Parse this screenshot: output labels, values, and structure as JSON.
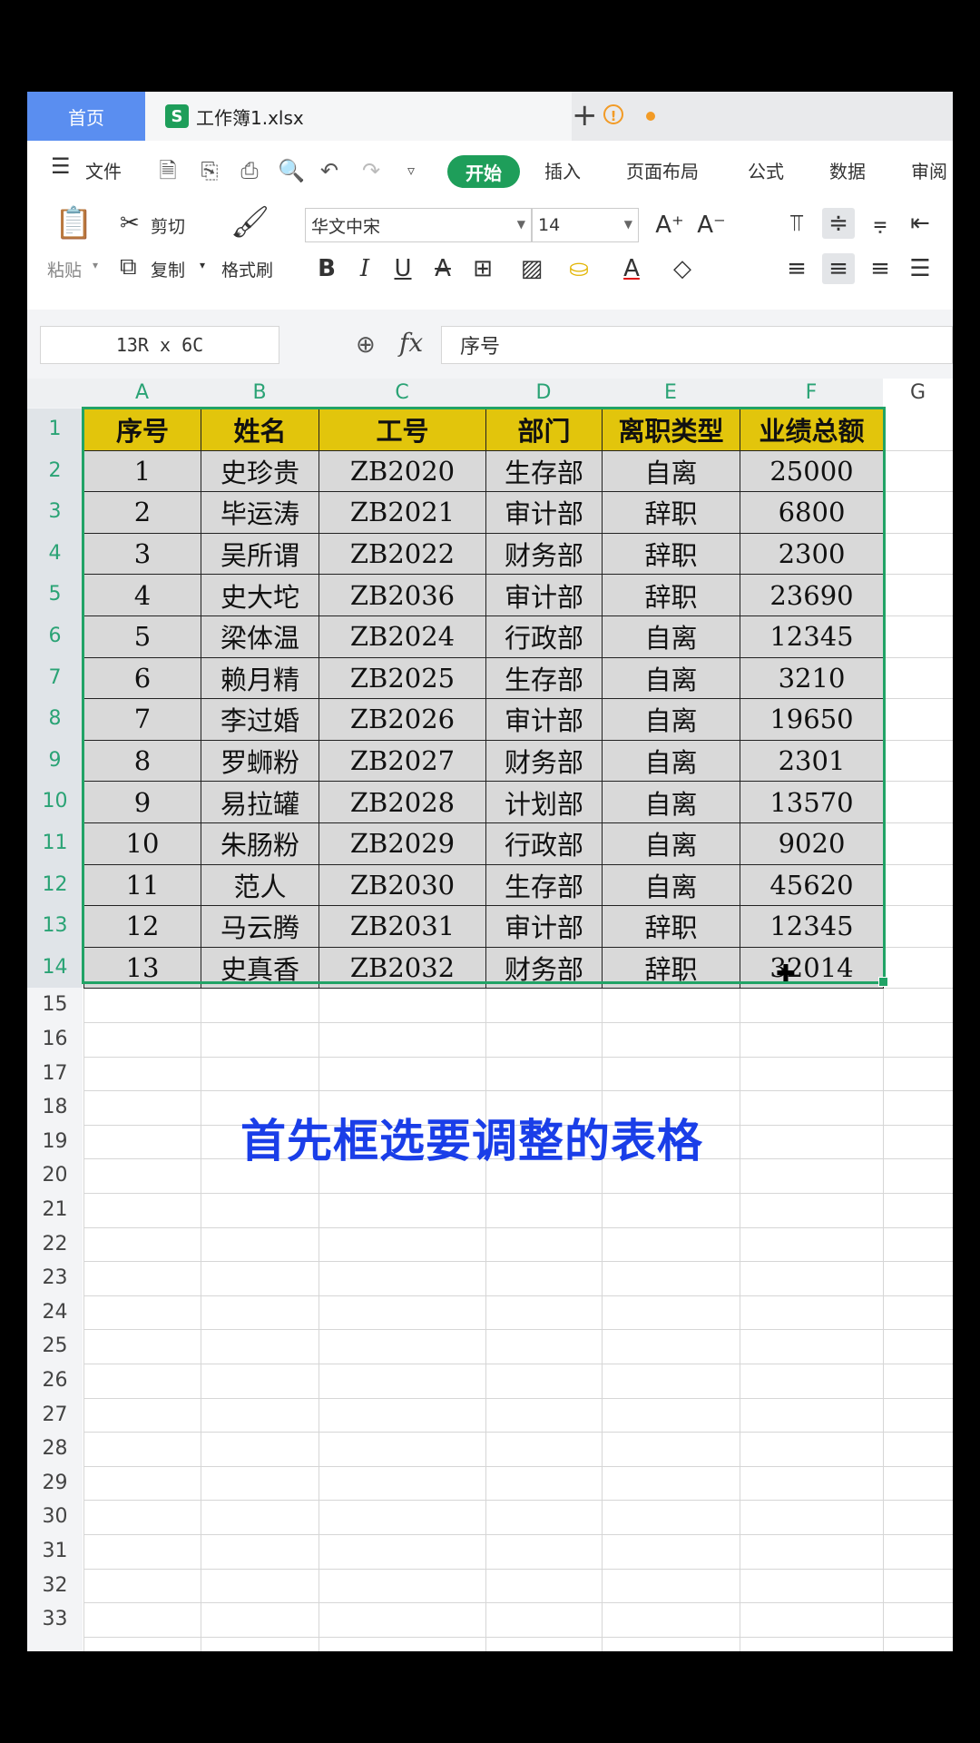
{
  "tabs": {
    "home_label": "首页",
    "file_icon_letter": "S",
    "file_name": "工作簿1.xlsx",
    "warn_glyph": "!",
    "new_tab_glyph": "+"
  },
  "menu": {
    "file_label": "文件",
    "items": [
      "开始",
      "插入",
      "页面布局",
      "公式",
      "数据",
      "审阅"
    ]
  },
  "ribbon": {
    "cut": "剪切",
    "copy": "复制",
    "paste": "粘贴",
    "format_painter": "格式刷",
    "font_name": "华文中宋",
    "font_size": "14"
  },
  "formula_bar": {
    "name_box": "13R x 6C",
    "fx": "fx",
    "formula": "序号"
  },
  "columns": [
    "A",
    "B",
    "C",
    "D",
    "E",
    "F",
    "G"
  ],
  "table": {
    "headers": [
      "序号",
      "姓名",
      "工号",
      "部门",
      "离职类型",
      "业绩总额"
    ],
    "rows": [
      [
        "1",
        "史珍贵",
        "ZB2020",
        "生存部",
        "自离",
        "25000"
      ],
      [
        "2",
        "毕运涛",
        "ZB2021",
        "审计部",
        "辞职",
        "6800"
      ],
      [
        "3",
        "吴所谓",
        "ZB2022",
        "财务部",
        "辞职",
        "2300"
      ],
      [
        "4",
        "史大坨",
        "ZB2036",
        "审计部",
        "辞职",
        "23690"
      ],
      [
        "5",
        "梁体温",
        "ZB2024",
        "行政部",
        "自离",
        "12345"
      ],
      [
        "6",
        "赖月精",
        "ZB2025",
        "生存部",
        "自离",
        "3210"
      ],
      [
        "7",
        "李过婚",
        "ZB2026",
        "审计部",
        "自离",
        "19650"
      ],
      [
        "8",
        "罗蛳粉",
        "ZB2027",
        "财务部",
        "自离",
        "2301"
      ],
      [
        "9",
        "易拉罐",
        "ZB2028",
        "计划部",
        "自离",
        "13570"
      ],
      [
        "10",
        "朱肠粉",
        "ZB2029",
        "行政部",
        "自离",
        "9020"
      ],
      [
        "11",
        "范人",
        "ZB2030",
        "生存部",
        "自离",
        "45620"
      ],
      [
        "12",
        "马云腾",
        "ZB2031",
        "审计部",
        "辞职",
        "12345"
      ],
      [
        "13",
        "史真香",
        "ZB2032",
        "财务部",
        "辞职",
        "32014"
      ]
    ]
  },
  "caption": "首先框选要调整的表格",
  "colors": {
    "accent_green": "#1e9e5a",
    "header_yellow": "#e2c50c",
    "caption_blue": "#1a3ee8",
    "home_tab_blue": "#5a8ef0"
  }
}
